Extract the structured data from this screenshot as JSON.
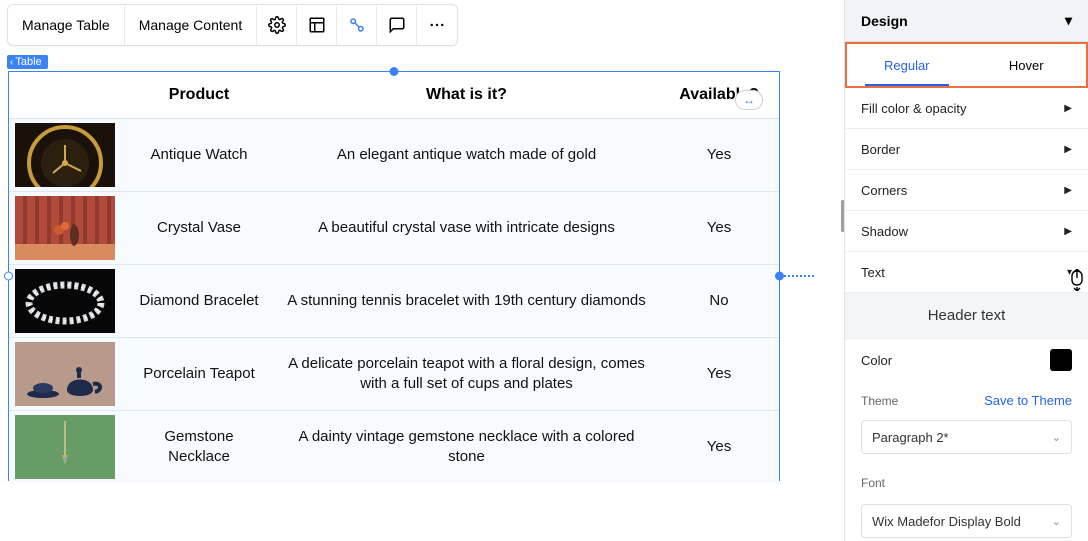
{
  "toolbar": {
    "manage_table": "Manage Table",
    "manage_content": "Manage Content"
  },
  "tag_label": "Table",
  "col_handle_glyph": "↔",
  "table": {
    "headers": [
      "",
      "Product",
      "What is it?",
      "Available?"
    ],
    "rows": [
      {
        "product": "Antique Watch",
        "desc": "An elegant antique watch made of gold",
        "available": "Yes"
      },
      {
        "product": "Crystal Vase",
        "desc": "A beautiful crystal vase with intricate designs",
        "available": "Yes"
      },
      {
        "product": "Diamond Bracelet",
        "desc": "A stunning tennis bracelet with 19th century diamonds",
        "available": "No"
      },
      {
        "product": "Porcelain Teapot",
        "desc": "A delicate porcelain teapot with a floral design, comes with a full set of cups and plates",
        "available": "Yes"
      },
      {
        "product": "Gemstone Necklace",
        "desc": "A dainty vintage gemstone necklace with a colored stone",
        "available": "Yes"
      }
    ]
  },
  "panel": {
    "title": "Design",
    "tabs": {
      "regular": "Regular",
      "hover": "Hover"
    },
    "sections": {
      "fill": "Fill color & opacity",
      "border": "Border",
      "corners": "Corners",
      "shadow": "Shadow",
      "text": "Text"
    },
    "subhead": "Header text",
    "color_label": "Color",
    "theme_label": "Theme",
    "save_theme": "Save to Theme",
    "theme_value": "Paragraph 2*",
    "font_label": "Font",
    "font_value": "Wix Madefor Display Bold",
    "swatch_color": "#000000"
  }
}
